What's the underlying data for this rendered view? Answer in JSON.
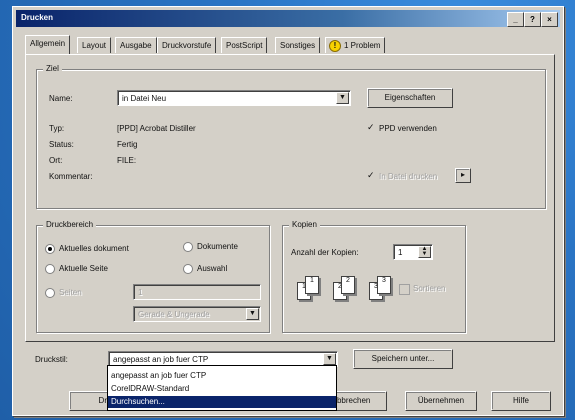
{
  "window": {
    "title": "Drucken",
    "btn_help": "?",
    "btn_close": "×",
    "btn_min": "_"
  },
  "tabs": [
    "Allgemein",
    "Layout",
    "Ausgabe",
    "Druckvorstufe",
    "PostScript",
    "Sonstiges",
    "1 Problem"
  ],
  "ziel": {
    "group_title": "Ziel",
    "name_label": "Name:",
    "name_value": "in Datei Neu",
    "properties_btn": "Eigenschaften",
    "typ_label": "Typ:",
    "typ_value": "[PPD] Acrobat Distiller",
    "status_label": "Status:",
    "status_value": "Fertig",
    "ort_label": "Ort:",
    "ort_value": "FILE:",
    "kommentar_label": "Kommentar:",
    "ppd_check": "PPD verwenden",
    "ppd_mark": "✓",
    "datei_check": "In Datei drucken",
    "datei_mark": "✓"
  },
  "druckbereich": {
    "group_title": "Druckbereich",
    "aktuelles": "Aktuelles dokument",
    "dokumente": "Dokumente",
    "aktuelle_seite": "Aktuelle Seite",
    "auswahl": "Auswahl",
    "seiten": "Seiten",
    "seiten_value": "1",
    "range_select": "Gerade & Ungerade"
  },
  "kopien": {
    "group_title": "Kopien",
    "anzahl_label": "Anzahl der Kopien:",
    "anzahl_value": "1",
    "sortieren": "Sortieren",
    "p1": "1",
    "p2": "2",
    "p3": "3"
  },
  "druckstil": {
    "label": "Druckstil:",
    "value": "angepasst an job fuer CTP",
    "save_btn": "Speichern unter...",
    "options": [
      "angepasst an job fuer CTP",
      "CorelDRAW-Standard",
      "Durchsuchen..."
    ]
  },
  "footer": {
    "b1": "Dru",
    "b2": "",
    "b3": "Abbrechen",
    "b4": "Übernehmen",
    "b5": "Hilfe"
  }
}
